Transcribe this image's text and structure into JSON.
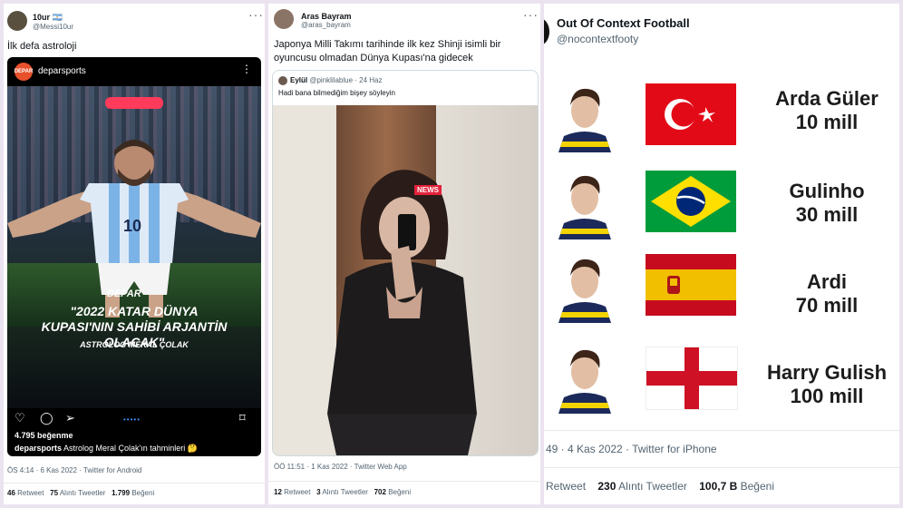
{
  "panel1": {
    "author_name": "10ur 🇦🇷",
    "author_handle": "@Messi10ur",
    "tweet_text": "İlk defa astroloji",
    "instagram": {
      "account": "deparsports",
      "logo_text": "DEPAR",
      "headline": "\"2022 KATAR DÜNYA KUPASI'NIN SAHİBİ ARJANTİN OLACAK\"",
      "brand_mark": "DEPAR",
      "subline": "ASTROLOG MERAL ÇOLAK",
      "jersey_number": "10",
      "likes": "4.795 beğenme",
      "caption_user": "deparsports",
      "caption_text": " Astrolog Meral Çolak'ın tahminleri 🤔"
    },
    "timestamp": "ÖS 4:14 · 6 Kas 2022 · Twitter for Android",
    "retweets_num": "46",
    "retweets_label": " Retweet",
    "quotes_num": "75",
    "quotes_label": " Alıntı Tweetler",
    "likes_num": "1.799",
    "likes_label": " Beğeni"
  },
  "panel2": {
    "author_name": "Aras Bayram",
    "author_handle": "@aras_bayram",
    "tweet_text": "Japonya Milli Takımı tarihinde ilk kez Shinji isimli bir oyuncusu olmadan Dünya Kupası'na gidecek",
    "quote": {
      "name": "Eylül",
      "handle_date": " @pinklilablue · 24 Haz",
      "text": "Hadi bana bilmediğim bişey söyleyin",
      "badge": "NEWS"
    },
    "timestamp": "ÖÖ 11:51 · 1 Kas 2022 · Twitter Web App",
    "retweets_num": "12",
    "retweets_label": " Retweet",
    "quotes_num": "3",
    "quotes_label": " Alıntı Tweetler",
    "likes_num": "702",
    "likes_label": " Beğeni"
  },
  "panel3": {
    "author_name": "Out Of Context Football",
    "author_handle": "@nocontextfooty",
    "rows": [
      {
        "name": "Arda Güler",
        "price": "10 mill",
        "flag": "turkey"
      },
      {
        "name": "Gulinho",
        "price": "30 mill",
        "flag": "brazil"
      },
      {
        "name": "Ardi",
        "price": "70 mill",
        "flag": "spain"
      },
      {
        "name": "Harry Gulish",
        "price": "100 mill",
        "flag": "england"
      }
    ],
    "timestamp": "49 · 4 Kas 2022 · Twitter for iPhone",
    "retweets_label": "Retweet",
    "quotes_num": "230",
    "quotes_label": " Alıntı Tweetler",
    "likes_num": "100,7 B",
    "likes_label": " Beğeni"
  },
  "colors": {
    "background": "#ece3f0",
    "twitter_gray": "#536471",
    "accent_red": "#ff3b5c",
    "turkey_red": "#e30a17",
    "brazil_green": "#009c3b",
    "spain_yellow": "#f1bf00",
    "england_red": "#ce1124"
  }
}
